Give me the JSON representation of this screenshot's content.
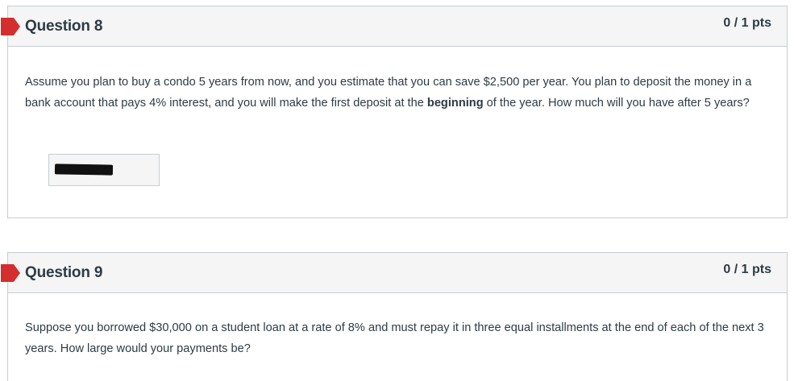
{
  "questions": [
    {
      "title": "Question 8",
      "points": "0 / 1 pts",
      "text_before": "Assume you plan to buy a condo 5 years from now, and you estimate that you can save $2,500 per year. You plan to deposit the money in a bank account that pays 4% interest, and you will make the first deposit at the ",
      "text_bold": "beginning",
      "text_after": " of the year. How much will you have after 5 years?",
      "answer_redacted": true
    },
    {
      "title": "Question 9",
      "points": "0 / 1 pts",
      "text": "Suppose you borrowed $30,000 on a student loan at a rate of 8% and must repay it in three equal installments at the end of each of the next 3 years. How large would your payments be?"
    }
  ],
  "colors": {
    "flag_incorrect": "#d32f2f",
    "header_bg": "#f5f5f5",
    "border": "#c7cdd1",
    "text": "#2d3b45"
  },
  "icons": {
    "flag": "incorrect-flag-icon"
  }
}
